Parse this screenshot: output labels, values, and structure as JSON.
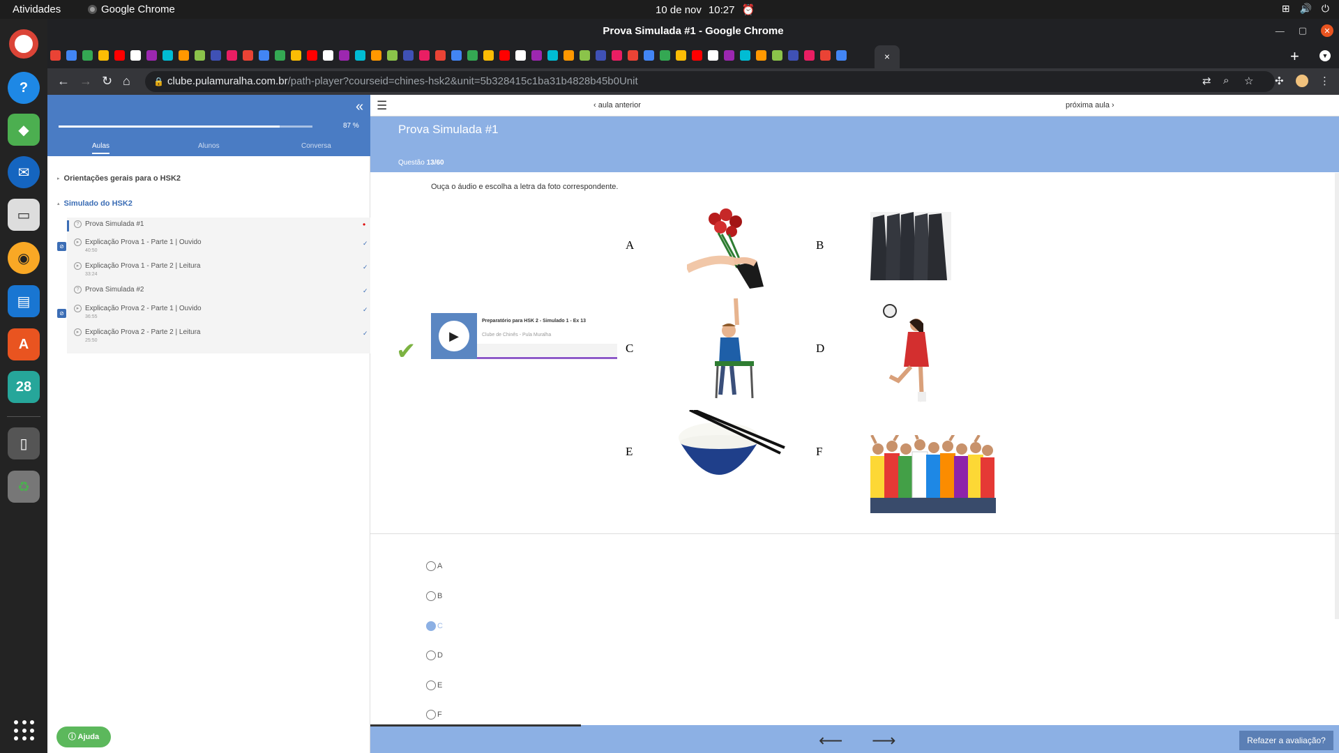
{
  "os": {
    "activities": "Atividades",
    "app_name": "Google Chrome",
    "date": "10 de nov",
    "time": "10:27"
  },
  "dock": {
    "calendar_day": "28",
    "items": [
      "chrome",
      "help",
      "app-center",
      "thunderbird",
      "files",
      "rhythmbox",
      "writer",
      "software",
      "calendar",
      "phone",
      "trash"
    ]
  },
  "browser": {
    "window_title": "Prova Simulada #1 - Google Chrome",
    "url_host": "clube.pulamuralha.com.br",
    "url_path": "/path-player?courseid=chines-hsk2&unit=5b328415c1ba31b4828b45b0Unit",
    "tab_close": "×",
    "new_tab": "+"
  },
  "sidebar": {
    "progress_percent": 87,
    "progress_label": "87 %",
    "tabs": [
      "Aulas",
      "Alunos",
      "Conversa"
    ],
    "sections": [
      {
        "title": "Orientações gerais para o HSK2"
      },
      {
        "title": "Simulado do HSK2"
      }
    ],
    "lessons": [
      {
        "title": "Prova Simulada #1",
        "duration": "",
        "type": "quiz",
        "status": "current"
      },
      {
        "title": "Explicação Prova 1 - Parte 1 | Ouvido",
        "duration": "40:50",
        "type": "video",
        "status": "done"
      },
      {
        "title": "Explicação Prova 1 - Parte 2 | Leitura",
        "duration": "33:24",
        "type": "video",
        "status": "done"
      },
      {
        "title": "Prova Simulada #2",
        "duration": "",
        "type": "quiz",
        "status": "done"
      },
      {
        "title": "Explicação Prova 2 - Parte 1 | Ouvido",
        "duration": "36:55",
        "type": "video",
        "status": "done"
      },
      {
        "title": "Explicação Prova 2 - Parte 2 | Leitura",
        "duration": "25:50",
        "type": "video",
        "status": "done"
      }
    ],
    "help_label": "Ajuda"
  },
  "main": {
    "prev_label": "aula anterior",
    "next_label": "próxima aula",
    "title": "Prova Simulada #1",
    "question_prefix": "Questão",
    "question_number": "13/60",
    "instruction": "Ouça o áudio e escolha a letra da foto correspondente.",
    "audio": {
      "title": "Preparatório para HSK 2 - Simulado 1 - Ex 13",
      "artist": "Clube de Chinês - Pula Muralha"
    },
    "figure_letters": [
      "A",
      "B",
      "C",
      "D",
      "E",
      "F"
    ],
    "options": [
      "A",
      "B",
      "C",
      "D",
      "E",
      "F"
    ],
    "selected_option": "C",
    "redo_label": "Refazer a avaliação?"
  },
  "colors": {
    "sidebar_header": "#4a7cc4",
    "main_header": "#8cb0e4",
    "check": "#7cb342",
    "help": "#5cb85c"
  }
}
